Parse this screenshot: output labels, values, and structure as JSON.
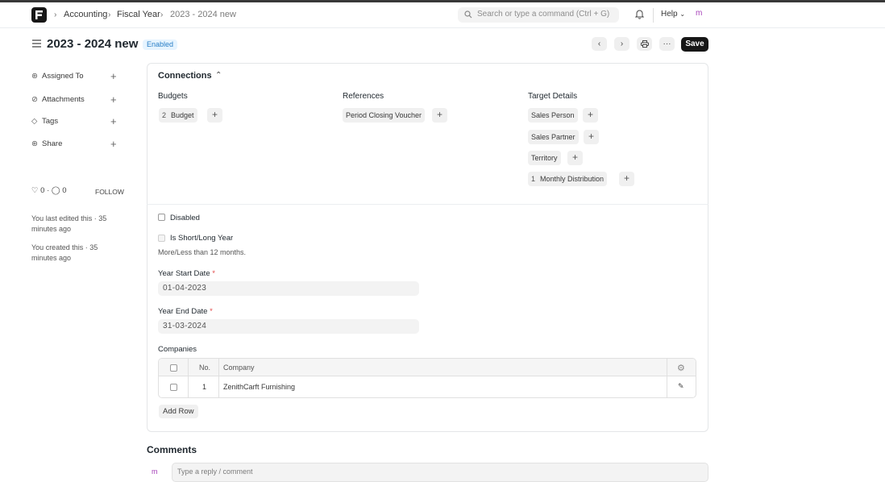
{
  "navbar": {
    "breadcrumbs": [
      "Accounting",
      "Fiscal Year",
      "2023 - 2024 new"
    ],
    "search_placeholder": "Search or type a command (Ctrl + G)",
    "help_label": "Help",
    "avatar_initial": "m"
  },
  "page": {
    "title": "2023 - 2024 new",
    "status_badge": "Enabled",
    "save_label": "Save",
    "more_label": "···"
  },
  "sidebar": {
    "items": [
      {
        "label": "Assigned To",
        "icon": "assign-icon"
      },
      {
        "label": "Attachments",
        "icon": "paperclip-icon"
      },
      {
        "label": "Tags",
        "icon": "tag-icon"
      },
      {
        "label": "Share",
        "icon": "share-icon"
      }
    ],
    "likes": "0",
    "comments_count": "0",
    "follow_label": "FOLLOW",
    "last_edited": "You last edited this · 35 minutes ago",
    "created": "You created this · 35 minutes ago"
  },
  "connections": {
    "title": "Connections",
    "columns": [
      {
        "heading": "Budgets",
        "links": [
          {
            "label": "Budget",
            "count": "2"
          }
        ]
      },
      {
        "heading": "References",
        "links": [
          {
            "label": "Period Closing Voucher",
            "count": ""
          }
        ]
      },
      {
        "heading": "Target Details",
        "links": [
          {
            "label": "Sales Person",
            "count": ""
          },
          {
            "label": "Sales Partner",
            "count": ""
          },
          {
            "label": "Territory",
            "count": ""
          },
          {
            "label": "Monthly Distribution",
            "count": "1"
          }
        ]
      }
    ]
  },
  "form": {
    "disabled_label": "Disabled",
    "short_long_label": "Is Short/Long Year",
    "short_long_desc": "More/Less than 12 months.",
    "start_date_label": "Year Start Date",
    "start_date_value": "01-04-2023",
    "end_date_label": "Year End Date",
    "end_date_value": "31-03-2024",
    "required_mark": "*",
    "companies_label": "Companies",
    "grid_headers": [
      "No.",
      "Company"
    ],
    "rows": [
      {
        "no": "1",
        "company": "ZenithCarft Furnishing"
      }
    ],
    "add_row_label": "Add Row"
  },
  "comments": {
    "heading": "Comments",
    "placeholder": "Type a reply / comment",
    "avatar_initial": "m"
  }
}
